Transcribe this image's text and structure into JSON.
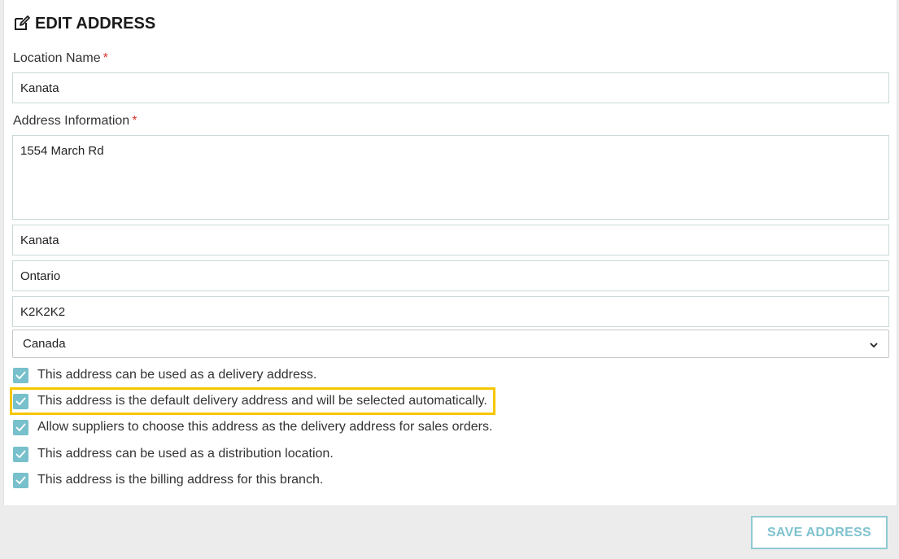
{
  "form": {
    "title": "EDIT ADDRESS",
    "title_icon": "edit-icon",
    "location_name": {
      "label": "Location Name",
      "required_mark": "*",
      "value": "Kanata"
    },
    "address_information": {
      "label": "Address Information",
      "required_mark": "*",
      "street": "1554 March Rd",
      "city": "Kanata",
      "province": "Ontario",
      "postal_code": "K2K2K2",
      "country": "Canada"
    },
    "options": [
      {
        "label": "This address can be used as a delivery address.",
        "checked": true
      },
      {
        "label": "This address is the default delivery address and will be selected automatically.",
        "checked": true
      },
      {
        "label": "Allow suppliers to choose this address as the delivery address for sales orders.",
        "checked": true
      },
      {
        "label": "This address can be used as a distribution location.",
        "checked": true
      },
      {
        "label": "This address is the billing address for this branch.",
        "checked": true
      }
    ]
  },
  "footer": {
    "save_label": "SAVE ADDRESS"
  },
  "colors": {
    "checkbox_fill": "#78c0cc",
    "highlight_border": "#f6c700",
    "required_mark": "#d9332c",
    "save_button_text": "#7fc3ce"
  }
}
